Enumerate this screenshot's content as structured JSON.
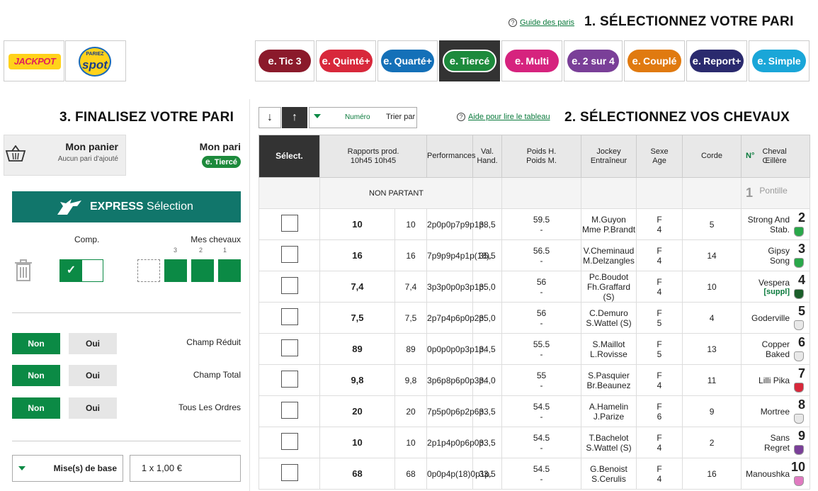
{
  "section1": {
    "title": "1. SÉLECTIONNEZ VOTRE PARI",
    "help": "Guide des paris"
  },
  "bet_types": [
    {
      "label": "Simple",
      "color": "#1aa6d8",
      "active": false
    },
    {
      "label": "Report+",
      "color": "#2a2a6e",
      "active": false
    },
    {
      "label": "Couplé",
      "color": "#e07a10",
      "active": false
    },
    {
      "label": "2 sur 4",
      "color": "#7a3f98",
      "active": false
    },
    {
      "label": "Multi",
      "color": "#d6237e",
      "active": false
    },
    {
      "label": "Tiercé",
      "color": "#1d8a3c",
      "active": true
    },
    {
      "label": "Quarté+",
      "color": "#1470b8",
      "active": false
    },
    {
      "label": "Quinté+",
      "color": "#d8283b",
      "active": false
    },
    {
      "label": "Tic 3",
      "color": "#8b1a2b",
      "active": false
    }
  ],
  "brands": {
    "spot": "spot",
    "spot_small": "PARIEZ",
    "jackpot": "JACKPOT"
  },
  "section2": {
    "title": "2. SÉLECTIONNEZ VOS CHEVAUX",
    "help": "Aide pour lire le tableau",
    "sort_label": "Trier par",
    "sort_value": "Numéro",
    "sort_asc": "↑",
    "sort_desc": "↓"
  },
  "table": {
    "headers": {
      "num": "N°",
      "horse": "Cheval\nŒillère",
      "corde": "Corde",
      "sexe": "Sexe\nAge",
      "jockey": "Jockey\nEntraîneur",
      "poids": "Poids H.\nPoids M.",
      "val": "Val.\nHand.",
      "perf": "Performances",
      "rapports": "Rapports prod.\n10h45   10h45",
      "select": "Sélect."
    },
    "non_partant": {
      "num": "1",
      "horse": "Pontille",
      "label": "NON PARTANT"
    },
    "rows": [
      {
        "num": "2",
        "horse": "Strong And Stab.",
        "suppl": "",
        "corde": "5",
        "sexe": "F",
        "age": "4",
        "jockey": "M.Guyon",
        "trainer": "Mme P.Brandt",
        "poids_h": "59.5",
        "poids_m": "-",
        "val": "38,5",
        "perf": "2p0p0p7p9p1p.",
        "r1": "10",
        "r2": "10",
        "jcolor": "#2aa84a"
      },
      {
        "num": "3",
        "horse": "Gipsy Song",
        "suppl": "",
        "corde": "14",
        "sexe": "F",
        "age": "4",
        "jockey": "V.Cheminaud",
        "trainer": "M.Delzangles",
        "poids_h": "56.5",
        "poids_m": "-",
        "val": "35,5",
        "perf": "7p9p9p4p1p(18).",
        "r1": "16",
        "r2": "16",
        "jcolor": "#2aa84a"
      },
      {
        "num": "4",
        "horse": "Vespera",
        "suppl": "[suppl]",
        "corde": "10",
        "sexe": "F",
        "age": "4",
        "jockey": "Pc.Boudot",
        "trainer": "Fh.Graffard (S)",
        "poids_h": "56",
        "poids_m": "-",
        "val": "35,0",
        "perf": "3p3p0p0p3p1p.",
        "r1": "7,4",
        "r2": "7,4",
        "jcolor": "#1b5e2a"
      },
      {
        "num": "5",
        "horse": "Goderville",
        "suppl": "",
        "corde": "4",
        "sexe": "F",
        "age": "5",
        "jockey": "C.Demuro",
        "trainer": "S.Wattel (S)",
        "poids_h": "56",
        "poids_m": "-",
        "val": "35,0",
        "perf": "2p7p4p6p0p2p.",
        "r1": "7,5",
        "r2": "7,5",
        "jcolor": "#e8e8e8"
      },
      {
        "num": "6",
        "horse": "Copper Baked",
        "suppl": "",
        "corde": "13",
        "sexe": "F",
        "age": "5",
        "jockey": "S.Maillot",
        "trainer": "L.Rovisse",
        "poids_h": "55.5",
        "poids_m": "-",
        "val": "34,5",
        "perf": "0p0p0p0p3p1p.",
        "r1": "89",
        "r2": "89",
        "jcolor": "#e8e8e8"
      },
      {
        "num": "7",
        "horse": "Lilli Pika",
        "suppl": "",
        "corde": "11",
        "sexe": "F",
        "age": "4",
        "jockey": "S.Pasquier",
        "trainer": "Br.Beaunez",
        "poids_h": "55",
        "poids_m": "-",
        "val": "34,0",
        "perf": "3p6p8p6p0p3p.",
        "r1": "9,8",
        "r2": "9,8",
        "jcolor": "#d8283b"
      },
      {
        "num": "8",
        "horse": "Mortree",
        "suppl": "",
        "corde": "9",
        "sexe": "F",
        "age": "6",
        "jockey": "A.Hamelin",
        "trainer": "J.Parize",
        "poids_h": "54.5",
        "poids_m": "-",
        "val": "33,5",
        "perf": "7p5p0p6p2p6p.",
        "r1": "20",
        "r2": "20",
        "jcolor": "#e8e8e8"
      },
      {
        "num": "9",
        "horse": "Sans Regret",
        "suppl": "",
        "corde": "2",
        "sexe": "F",
        "age": "4",
        "jockey": "T.Bachelot",
        "trainer": "S.Wattel (S)",
        "poids_h": "54.5",
        "poids_m": "-",
        "val": "33,5",
        "perf": "2p1p4p0p6p0p.",
        "r1": "10",
        "r2": "10",
        "jcolor": "#7a3f98"
      },
      {
        "num": "10",
        "horse": "Manoushka",
        "suppl": "",
        "corde": "16",
        "sexe": "F",
        "age": "4",
        "jockey": "G.Benoist",
        "trainer": "S.Cerulis",
        "poids_h": "54.5",
        "poids_m": "-",
        "val": "33,5",
        "perf": "0p0p4p(18)0p1p.",
        "r1": "68",
        "r2": "68",
        "jcolor": "#e07ac0"
      }
    ]
  },
  "section3": {
    "title": "3. FINALISEZ VOTRE PARI",
    "mon_pari": "Mon pari",
    "pari_badge": "Tiercé",
    "mon_panier": "Mon panier",
    "panier_sub": "Aucun pari d'ajouté",
    "express_label": "Sélection",
    "express_bold": "EXPRESS",
    "mes_chevaux": "Mes chevaux",
    "comp": "Comp.",
    "slot_labels": [
      "1",
      "2",
      "3"
    ],
    "champ_reduit": "Champ Réduit",
    "champ_total": "Champ Total",
    "tous_ordres": "Tous Les Ordres",
    "oui": "Oui",
    "non": "Non",
    "mise_label": "Mise(s) de base",
    "mise_value": "1 x 1,00 €"
  }
}
